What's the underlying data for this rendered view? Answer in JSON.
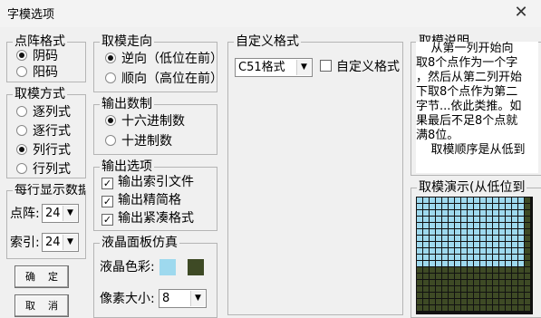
{
  "window": {
    "title": "字模选项",
    "close_glyph": "✕"
  },
  "dot_format": {
    "legend": "点阵格式",
    "options": [
      "阴码",
      "阳码"
    ],
    "selected": 0
  },
  "mode": {
    "legend": "取模方式",
    "options": [
      "逐列式",
      "逐行式",
      "列行式",
      "行列式"
    ],
    "selected": 2
  },
  "per_row": {
    "legend": "每行显示数据",
    "dot_label": "点阵:",
    "dot_value": "24",
    "index_label": "索引:",
    "index_value": "24"
  },
  "direction": {
    "legend": "取模走向",
    "options": [
      "逆向（低位在前）",
      "顺向（高位在前）"
    ],
    "selected": 0
  },
  "output_base": {
    "legend": "输出数制",
    "options": [
      "十六进制数",
      "十进制数"
    ],
    "selected": 0
  },
  "output_opts": {
    "legend": "输出选项",
    "items": [
      "输出索引文件",
      "输出精简格",
      "输出紧凑格式"
    ],
    "checked": [
      true,
      true,
      true
    ]
  },
  "lcd": {
    "legend": "液晶面板仿真",
    "color_label": "液晶色彩:",
    "color_light": "#9ed9ee",
    "color_dark": "#3e4a25",
    "pixel_label": "像素大小:",
    "pixel_value": "8"
  },
  "custom": {
    "legend": "自定义格式",
    "format_value": "C51格式",
    "checkbox_label": "自定义格式",
    "checked": false
  },
  "description": {
    "legend": "取模说明",
    "lines": [
      "    从第一列开始向",
      "取8个点作为一个字",
      "，然后从第二列开始",
      "下取8个点作为第二",
      "字节...依此类推。如",
      "果最后不足8个点就",
      "满8位。",
      "    取模顺序是从低到"
    ]
  },
  "demo": {
    "legend": "取模演示(从低位到"
  },
  "buttons": {
    "ok": "确    定",
    "cancel": "取    消"
  }
}
